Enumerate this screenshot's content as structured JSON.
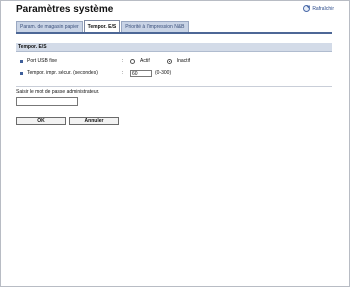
{
  "header": {
    "title": "Paramètres système",
    "refresh_label": "Rafraîchir",
    "refresh_icon": "refresh-icon"
  },
  "tabs": [
    {
      "label": "Param. de magasin papier",
      "active": false
    },
    {
      "label": "Tempor. E/S",
      "active": true
    },
    {
      "label": "Priorité à l'impression N&B",
      "active": false
    }
  ],
  "section": {
    "title": "Tempor. E/S",
    "rows": [
      {
        "label": "Port USB fixe",
        "colon": ":",
        "options": [
          {
            "label": "Actif",
            "selected": false
          },
          {
            "label": "Inactif",
            "selected": true
          }
        ]
      },
      {
        "label": "Tempor. impr. sécur. (secondes)",
        "colon": ":",
        "value": "60",
        "range": "(0-300)"
      }
    ]
  },
  "admin_password": {
    "label": "Saisir le mot de passe administrateur.",
    "value": ""
  },
  "buttons": {
    "ok": "OK",
    "cancel": "Annuler"
  },
  "colors": {
    "tab_active_line": "#4d6796",
    "section_header_bg": "#d3dbe8",
    "tab_inactive_bg": "#c9d4e6"
  }
}
